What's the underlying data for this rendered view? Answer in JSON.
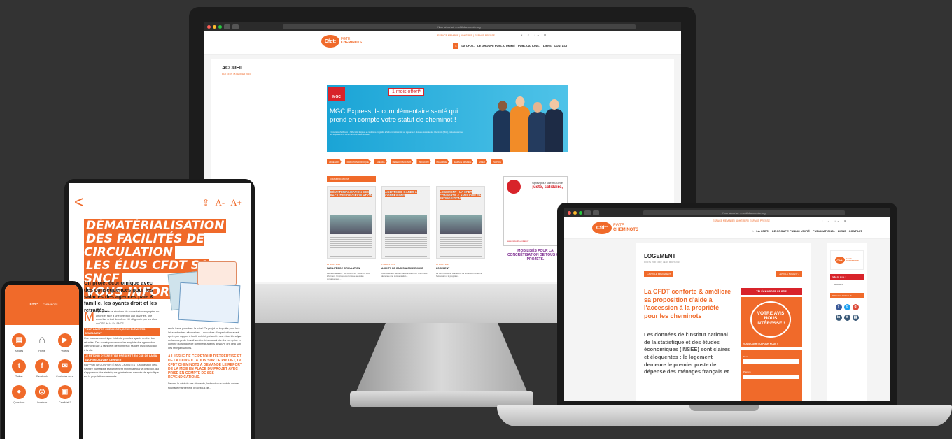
{
  "desktop": {
    "url": "Non sécurisé — cfdtcheminots.org",
    "logo": {
      "badge": "Cfdt:",
      "line1": "FGTE",
      "line2": "CHEMINOTS"
    },
    "top_links": "ESPACE MEMBRE  |  ADHÉRER  |  ESPACE PRESSE",
    "social": "f ✓ in ⊞",
    "menu": [
      "⌂",
      "LA CFDT..",
      "LE GROUPE PUBLIC UNIFIÉ",
      "PUBLICATIONS..",
      "LIENS",
      "CONTACT"
    ],
    "page_title": "ACCUEIL",
    "page_date": "PAR CFDT, 15 FÉVRIER 2023",
    "banner": {
      "brand": "MGC",
      "offer": "1 mois offert*",
      "headline": "MGC Express, la complémentaire santé qui prend en compte votre statut de cheminot !",
      "fine": "* Conditions d'adhésion à l'offre MGC Express et conditions d'éligibilité à l'offre promotionnelle sur mgcsante.fr. Mutuelle Générale des Cheminots (MGC), mutuelle soumise aux dispositions du Livre II du Code de la Mutualité."
    },
    "categories": [
      "ADHÉSION",
      "DIRECTION JURIDIQUE",
      "AGENDA",
      "RÉSEAUX SOCIAUX",
      "TECHCOM",
      "MAGAZINE",
      "ESPACE MEMBRE",
      "VIDÉO",
      "PHOTOS"
    ],
    "section": "COMMUNICATIONS",
    "posts": [
      {
        "thumb_title": "DÉMATÉRIALISATION DES FACILITÉS DE CIRCULATION",
        "date": "23 MARS 2023",
        "name": "FACILITÉS DE CIRCULATION",
        "excerpt": "Dématérialisation : Les élus CFDT SA SNCF vous informent. Un projet économique avec des conséquences..."
      },
      {
        "thumb_title": "AGENTS DE GARES & CONNEXIONS",
        "date": "17 MARS 2023",
        "name": "AGENTS DE GARES & CONNEXIONS",
        "excerpt": "Intéressement : année blanche. La CFDT Cheminots demande une compensation..."
      },
      {
        "thumb_title": "LOGEMENT : LA CFDT CONFORTE & AMÉLIORE SA PROPOSITION",
        "date": "16 MARS 2023",
        "name": "LOGEMENT",
        "excerpt": "La CFDT conforte & améliore sa proposition d'aide à l'accession à la propriété..."
      }
    ],
    "ad": {
      "line1": "Optez pour une mutuelle",
      "line2": "juste, solidaire,",
      "url": "www.mutuelle-entrain.fr",
      "bottom": "MOBILISÉS POUR LA CONCRÉTISATION DE TOUS VOS PROJETS."
    }
  },
  "tablet": {
    "back": "<",
    "share": "⇪",
    "font_small": "A-",
    "font_big": "A+",
    "headline": [
      "DÉMATÉRIALISATION",
      "DES FACILITÉS DE CIRCULATION",
      "LES ÉLUS CFDT SA SNCF",
      "VOUS INFORMENT"
    ],
    "lead": "Un projet économique avec des conséquences pour les salariés des agences paie & famille, les ayants droit et les retraités...",
    "dropcap": "M",
    "body": "algré plusieurs réunions de concertation engagées en amont et face à une direction aux ouvertes, une expertise a tout de même été diligentée par les élus du CSE de la SA SNCF.",
    "sub1": "POUR LA CFDT CHEMINOTS, DEUX ÉLÉMENTS SEMBLAIENT",
    "body2": "Une fracture numérique évidente pour les ayants droit et les retraités. Des conséquences sur les emplois des agents des agences paie & famille et de nombreux risques psychosociaux à la clé.",
    "sub2": "LE RETOUR D'EXPERTISE PRÉSENTÉ EN CSE DE LA SA SNCF EN JANVIER DERNIER",
    "body3": "RAPPORT A CONFORTÉ NOS CRAINTES ! La question de la fracture numérique est largement minimisée par la direction, qui s'appuie sur des statistiques généralistes sans étude spécifique sur la population cheminote.",
    "col2": "seule issue possible : la paie ! Ce projet va trop vite pour leur laisser d'autres alternatives. Les cadres d'organisation avant après par rapport à l'outil ont été présentés aux élus. L'analyse de la charge de travail semble très maladroite. La non prise en compte du fait que de nombreux agents des APF ont déjà subi des réorganisations.",
    "col2_heading": "À L'ISSUE DE CE RETOUR D'EXPERTISE ET DE LA CONSULTATION SUR CE PROJET, LA CFDT CHEMINOTS A DEMANDÉ LE REPORT DE LA MISE EN PLACE DU PROJET AVEC PRISE EN COMPTE DE SES REVENDICATIONS.",
    "col2_more": "Devant le déni de ces éléments, la direction a tout de même souhaité maintenir le processus de..."
  },
  "phone": {
    "logo_badge": "Cfdt:",
    "logo_text": "CHEMINOTS",
    "items": [
      {
        "label": "Articles",
        "icon": "articles-icon",
        "glyph": "▤"
      },
      {
        "label": "Home",
        "icon": "home-icon",
        "glyph": "⌂"
      },
      {
        "label": "Vidéos",
        "icon": "video-icon",
        "glyph": "▶"
      },
      {
        "label": "Twitter",
        "icon": "twitter-icon",
        "glyph": "t"
      },
      {
        "label": "Facebook",
        "icon": "facebook-icon",
        "glyph": "f"
      },
      {
        "label": "Contactez-nous",
        "icon": "mail-icon",
        "glyph": "✉"
      },
      {
        "label": "Questions",
        "icon": "person-icon",
        "glyph": "●"
      },
      {
        "label": "Localiser",
        "icon": "locate-icon",
        "glyph": "◎"
      },
      {
        "label": "Candidat ?",
        "icon": "candidate-icon",
        "glyph": "▣"
      }
    ]
  },
  "laptop": {
    "url": "Non sécurisé — cfdtcheminots.org",
    "top_links": "ESPACE MEMBRE  |  ADHÉRER  |  ESPACE PRESSE",
    "social": "f ✓ in ⊞",
    "menu": [
      "⌂",
      "LA CFDT..",
      "LE GROUPE PUBLIC UNIFIÉ",
      "PUBLICATIONS..",
      "LIENS",
      "CONTACT"
    ],
    "title": "LOGEMENT",
    "date": "POSTÉ PAR CFDT, LE 16 MARS 2023",
    "prev": "« ARTICLE PRÉCÉDENT",
    "next": "ARTICLE SUIVANT »",
    "h2": "La CFDT conforte & améliore sa proposition d'aide à l'accession à la propriété pour les cheminots",
    "p": "Les données de l'Institut national de la statistique et des études économiques (INSEE) sont claires et éloquentes : le logement demeure le premier poste de dépense des ménages français et",
    "download": "TÉLÉCHARGER LE PDF",
    "poster": "VOTRE AVIS NOUS INTÉRESSE !",
    "poster_foot": "VOUS COMPTEZ POUR NOUS !",
    "form_labels": [
      "Nom",
      "Prénom"
    ],
    "font_size": "Taille du texte :",
    "print": "IMPRIMER",
    "reseaux": "RÉSEAUX SOCIAUX"
  },
  "colors": {
    "accent": "#f06a2a",
    "red": "#d8232a",
    "banner": "#1aa4d6"
  }
}
